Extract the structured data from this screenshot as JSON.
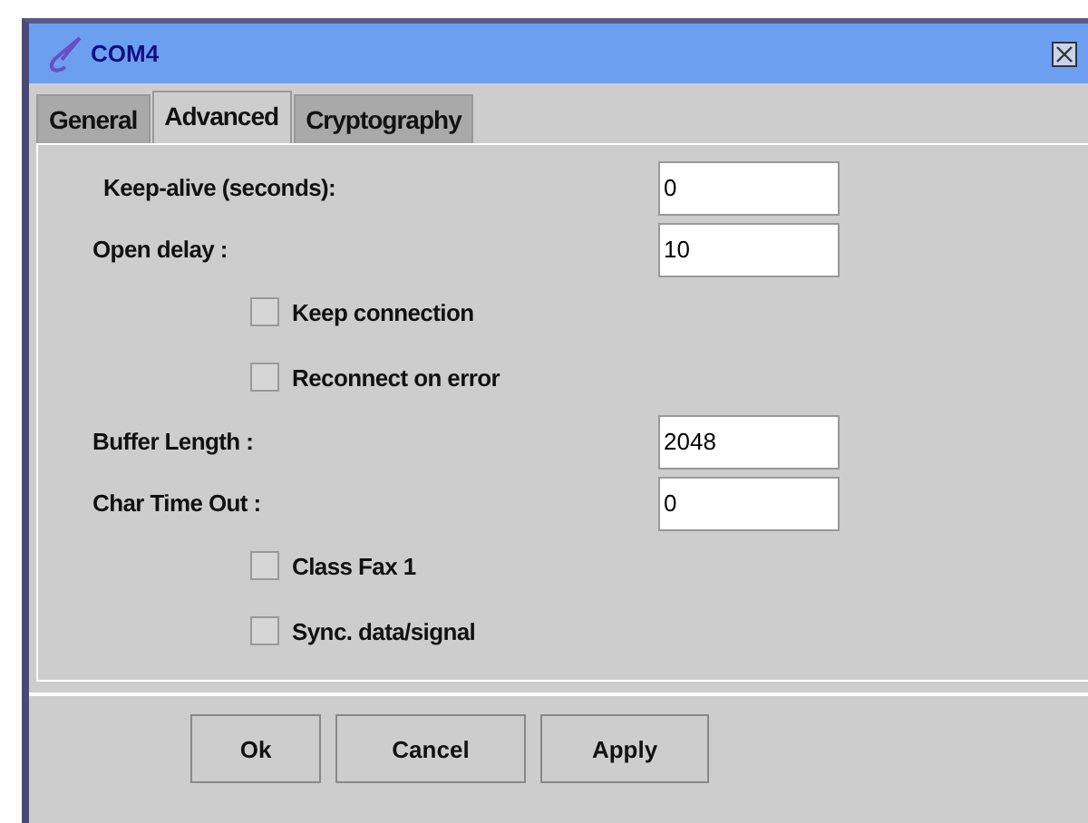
{
  "window": {
    "title": "COM4"
  },
  "tabs": [
    {
      "label": "General",
      "selected": false
    },
    {
      "label": "Advanced",
      "selected": true
    },
    {
      "label": "Cryptography",
      "selected": false
    }
  ],
  "rows": [
    {
      "kind": "field",
      "label": "Keep-alive (seconds):",
      "value": "0"
    },
    {
      "kind": "field",
      "label": "Open delay :",
      "value": "10"
    },
    {
      "kind": "checkbox",
      "label": "Keep connection",
      "checked": false
    },
    {
      "kind": "checkbox",
      "label": "Reconnect on error",
      "checked": false
    },
    {
      "kind": "field",
      "label": "Buffer Length :",
      "value": "2048"
    },
    {
      "kind": "field",
      "label": "Char Time Out :",
      "value": "0"
    },
    {
      "kind": "checkbox",
      "label": "Class Fax 1",
      "checked": false
    },
    {
      "kind": "checkbox",
      "label": "Sync. data/signal",
      "checked": false
    }
  ],
  "buttons": [
    "Ok",
    "Cancel",
    "Apply"
  ]
}
